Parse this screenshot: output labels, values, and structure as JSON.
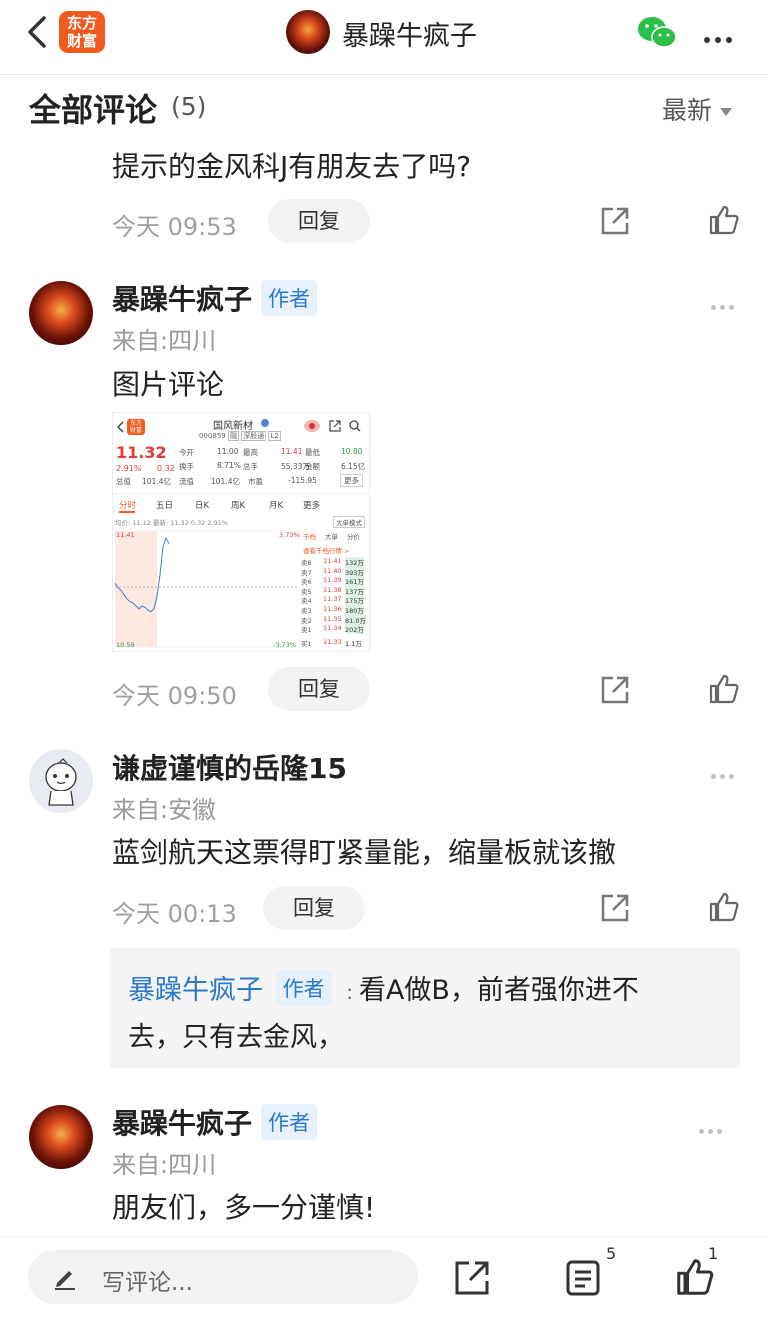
{
  "header": {
    "logo_line1": "东方",
    "logo_line2": "财富",
    "title": "暴躁牛疯子"
  },
  "section": {
    "title": "全部评论",
    "count": "(5)",
    "sort_label": "最新"
  },
  "comments": [
    {
      "text": "提示的金风科J有朋友去了吗?",
      "time": "今天 09:53",
      "reply_label": "回复"
    },
    {
      "author": "暴躁牛疯子",
      "tag": "作者",
      "location": "来自:四川",
      "text": "图片评论",
      "time": "今天 09:50",
      "reply_label": "回复",
      "image": {
        "logo_line1": "东方",
        "logo_line2": "财富",
        "stock_name": "国风新材",
        "stock_code": "000859",
        "code_tags": [
          "融",
          "深股通",
          "L2"
        ],
        "price": "11.32",
        "change_pct": "2.91%",
        "change": "0.32",
        "stats": [
          [
            "今开",
            "11.00",
            "最高",
            "11.41",
            "最低",
            "10.80"
          ],
          [
            "换手",
            "8.71%",
            "总手",
            "55.33万",
            "金额",
            "6.15亿"
          ],
          [
            "总值",
            "101.4亿",
            "流值",
            "101.4亿",
            "市盈",
            "-115.95"
          ]
        ],
        "more_label": "更多",
        "tabs": [
          "分时",
          "五日",
          "日K",
          "周K",
          "月K",
          "更多"
        ],
        "avg_line": "均价: 11.12  最新: 11.32  0.32  2.91%",
        "mode_label": "大单模式",
        "price_top": "11.41",
        "price_mid": "11.00",
        "price_bottom": "10.59",
        "pct_top": "3.73%",
        "pct_bottom": "-3.73%",
        "order_tabs": [
          "千档",
          "大单",
          "分价"
        ],
        "orderbook_link": "查看千档行情 >",
        "orders": [
          [
            "卖8",
            "11.41",
            "132万"
          ],
          [
            "卖7",
            "11.40",
            "393万"
          ],
          [
            "卖6",
            "11.39",
            "161万"
          ],
          [
            "卖5",
            "11.38",
            "137万"
          ],
          [
            "卖4",
            "11.37",
            "175万"
          ],
          [
            "卖3",
            "11.36",
            "180万"
          ],
          [
            "卖2",
            "11.35",
            "81.0万"
          ],
          [
            "卖1",
            "11.34",
            "202万"
          ],
          [
            "买1",
            "11.33",
            "1.1万"
          ]
        ],
        "intraday_prices": [
          11.04,
          11.01,
          10.99,
          10.96,
          10.93,
          10.91,
          10.9,
          10.88,
          10.86,
          10.88,
          10.87,
          10.85,
          10.84,
          10.86,
          10.95,
          11.1,
          11.3,
          11.36,
          11.32
        ]
      }
    },
    {
      "author": "谦虚谨慎的岳隆15",
      "location": "来自:安徽",
      "text": "蓝剑航天这票得盯紧量能，缩量板就该撤",
      "time": "今天 00:13",
      "reply_label": "回复",
      "quote": {
        "author": "暴躁牛疯子",
        "tag": "作者",
        "colon": ":",
        "line1": "看A做B，前者强你进不",
        "line2": "去，只有去金风，"
      }
    },
    {
      "author": "暴躁牛疯子",
      "tag": "作者",
      "location": "来自:四川",
      "text": "朋友们，多一分谨慎!"
    }
  ],
  "bottom": {
    "input_placeholder": "写评论...",
    "comment_count": "5",
    "like_count": "1"
  },
  "colors": {
    "brand": "#f25a1f",
    "author_tag_bg": "#e7f1fb",
    "author_tag_text": "#2a78c9",
    "quote_name": "#2a78c9",
    "stock_up": "#e23b3b",
    "stock_down": "#2e9a4f"
  }
}
